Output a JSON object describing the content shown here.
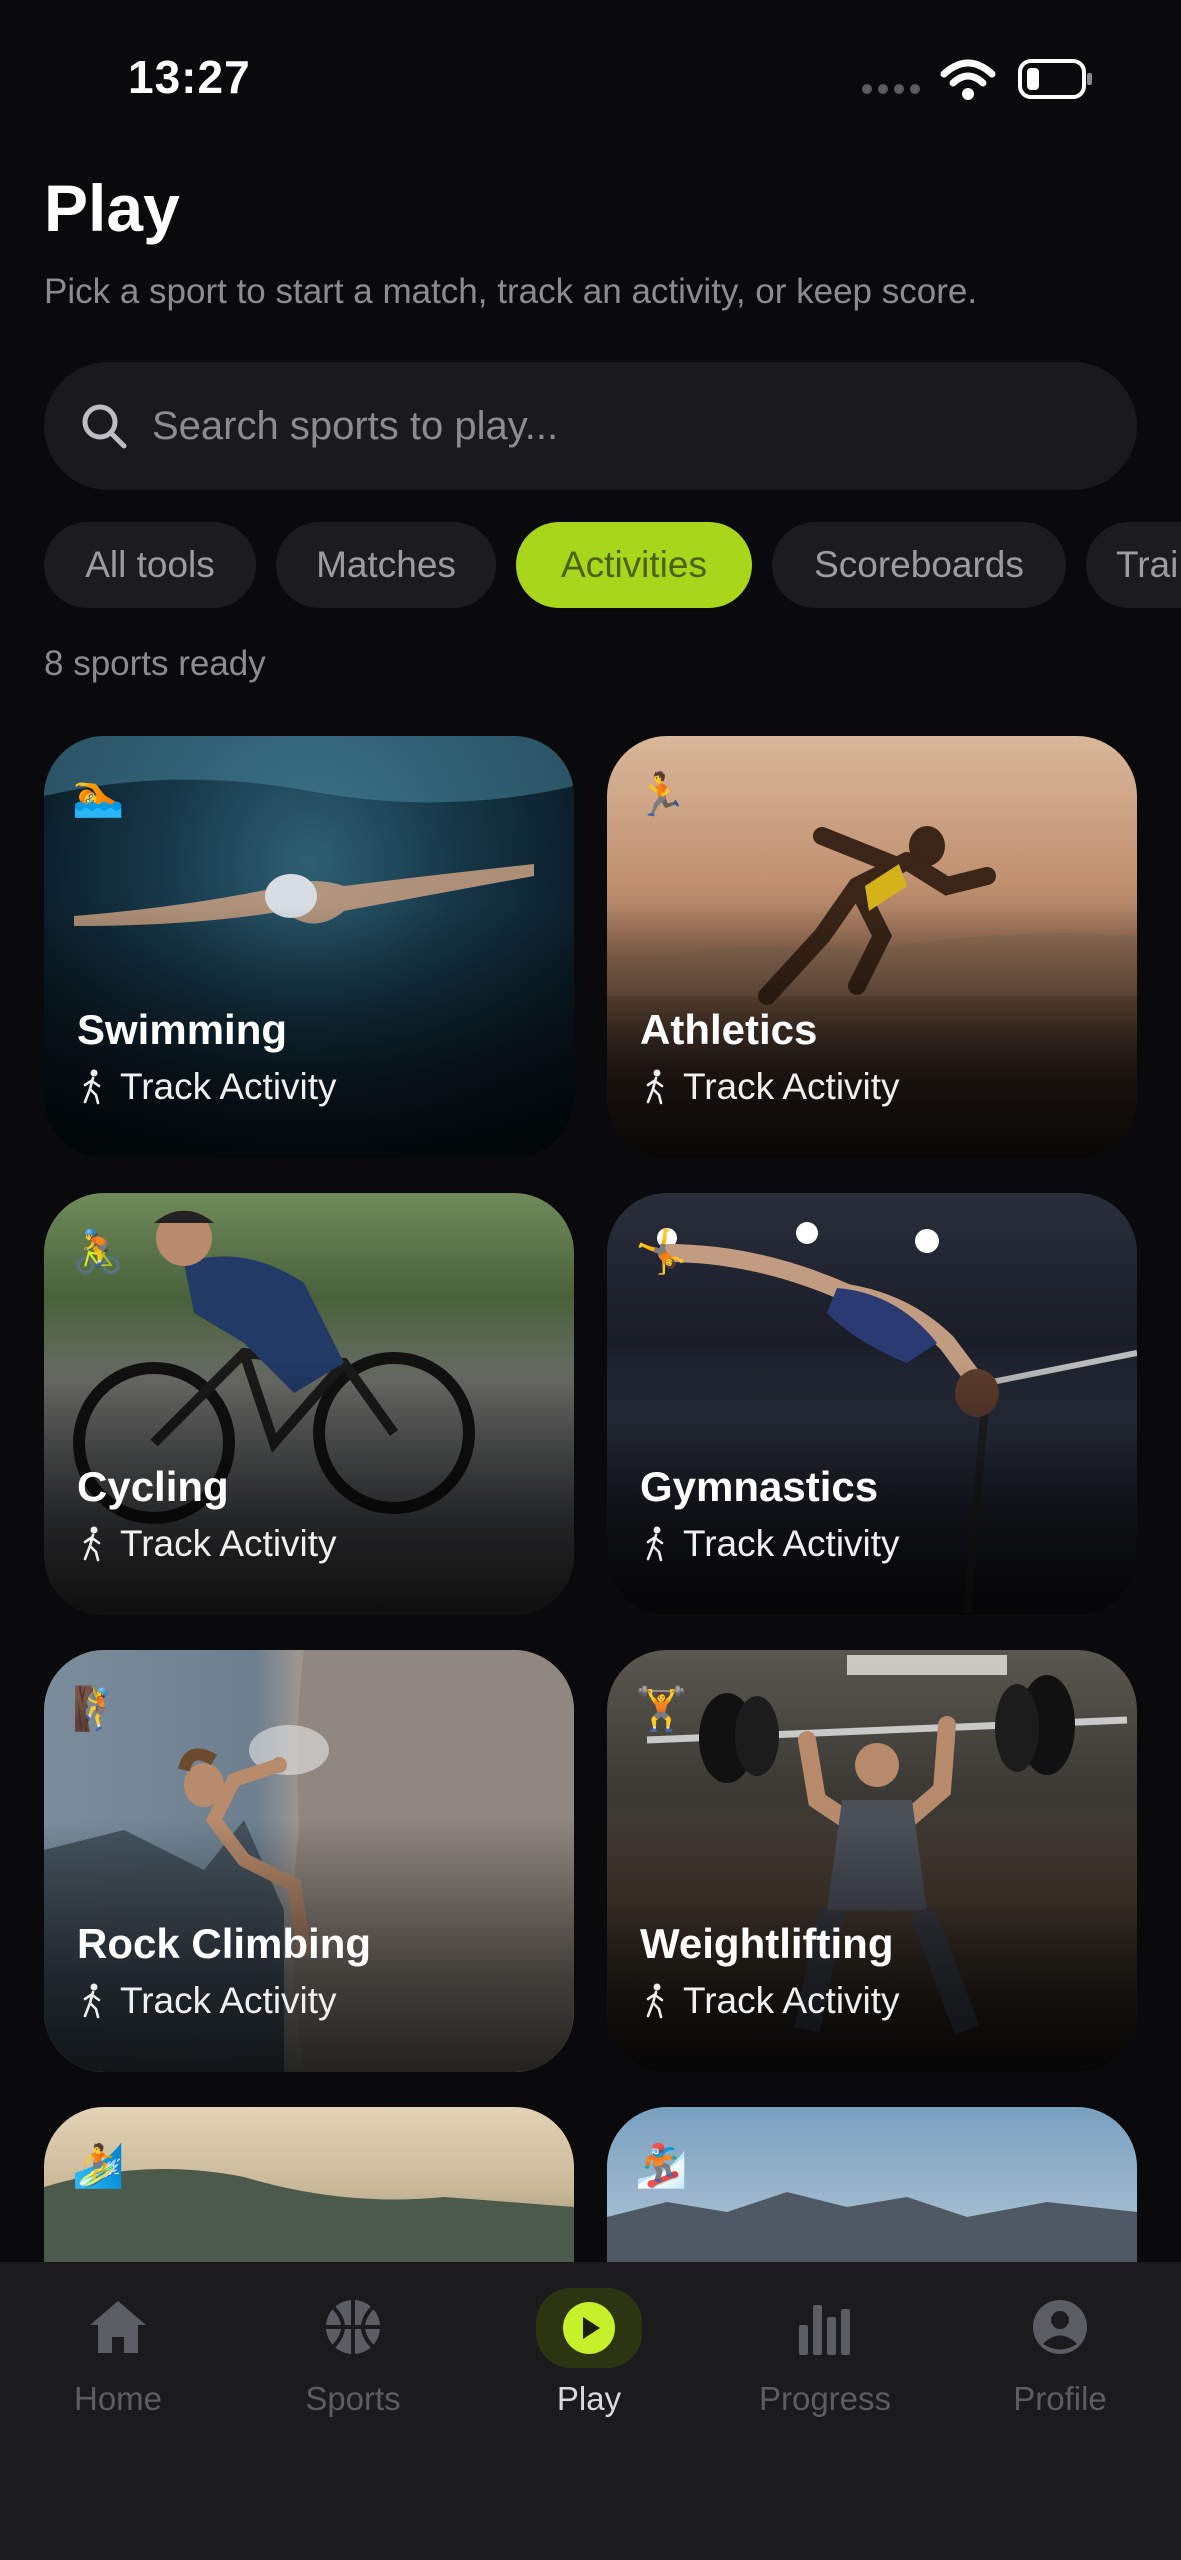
{
  "status_bar": {
    "time": "13:27"
  },
  "header": {
    "title": "Play",
    "subtitle": "Pick a sport to start a match, track an activity, or keep score."
  },
  "search": {
    "placeholder": "Search sports to play..."
  },
  "filters": {
    "chips": [
      "All tools",
      "Matches",
      "Activities",
      "Scoreboards",
      "Trai"
    ],
    "selected": "Activities"
  },
  "count_text": "8 sports ready",
  "cards": [
    {
      "name": "Swimming",
      "action": "Track Activity",
      "emoji": "🏊"
    },
    {
      "name": "Athletics",
      "action": "Track Activity",
      "emoji": "🏃"
    },
    {
      "name": "Cycling",
      "action": "Track Activity",
      "emoji": "🚴"
    },
    {
      "name": "Gymnastics",
      "action": "Track Activity",
      "emoji": "🤸"
    },
    {
      "name": "Rock Climbing",
      "action": "Track Activity",
      "emoji": "🧗"
    },
    {
      "name": "Weightlifting",
      "action": "Track Activity",
      "emoji": "🏋️"
    },
    {
      "name": "",
      "action": "",
      "emoji": "🏄"
    },
    {
      "name": "",
      "action": "",
      "emoji": "🏂"
    }
  ],
  "bottom_nav": {
    "items": [
      {
        "label": "Home",
        "icon": "home-icon"
      },
      {
        "label": "Sports",
        "icon": "basketball-icon"
      },
      {
        "label": "Play",
        "icon": "play-icon"
      },
      {
        "label": "Progress",
        "icon": "bar-chart-icon"
      },
      {
        "label": "Profile",
        "icon": "person-icon"
      }
    ],
    "active": "Play"
  },
  "colors": {
    "accent": "#a8d61a",
    "background": "#0a0a0c",
    "surface": "#1a1a1d"
  }
}
